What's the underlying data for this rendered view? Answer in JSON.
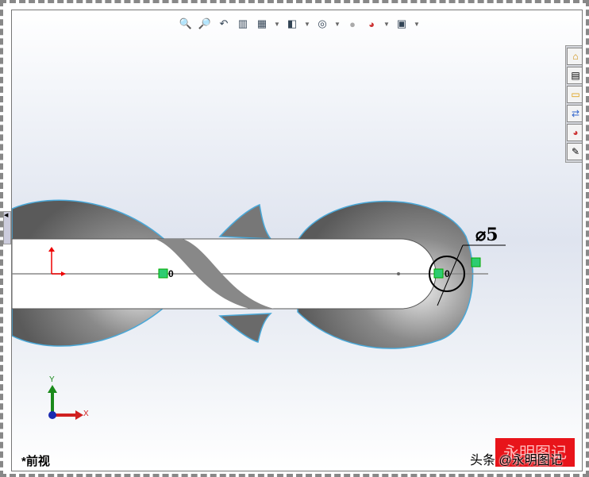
{
  "hud_toolbar": {
    "items": [
      {
        "name": "zoom-to-fit-icon",
        "glyph": "🔍"
      },
      {
        "name": "zoom-to-area-icon",
        "glyph": "🔎"
      },
      {
        "name": "previous-view-icon",
        "glyph": "↶"
      },
      {
        "name": "section-view-icon",
        "glyph": "▥"
      },
      {
        "name": "view-orientation-icon",
        "glyph": "▦",
        "dropdown": true
      },
      {
        "name": "display-style-icon",
        "glyph": "◧",
        "dropdown": true
      },
      {
        "name": "hide-show-items-icon",
        "glyph": "◎",
        "dropdown": true
      },
      {
        "name": "edit-appearance-icon",
        "glyph": "●"
      },
      {
        "name": "apply-scene-icon",
        "glyph": "◕",
        "dropdown": true
      },
      {
        "name": "view-settings-icon",
        "glyph": "▣",
        "dropdown": true
      }
    ]
  },
  "task_pane": {
    "items": [
      {
        "name": "home-icon",
        "glyph": "⌂"
      },
      {
        "name": "design-library-icon",
        "glyph": "▤"
      },
      {
        "name": "file-explorer-icon",
        "glyph": "▭"
      },
      {
        "name": "view-palette-icon",
        "glyph": "⇄"
      },
      {
        "name": "appearances-icon",
        "glyph": "◕"
      },
      {
        "name": "custom-properties-icon",
        "glyph": "✎"
      }
    ]
  },
  "sketch": {
    "dimension": "⌀5",
    "origin_label_1": "0",
    "origin_label_2": "0"
  },
  "triad": {
    "x": "X",
    "y": "Y"
  },
  "view_name": "*前视",
  "watermark": "头条 @永明图记",
  "seal_text": "永明图记",
  "colors": {
    "seal": "#e8141a",
    "triad_x": "#d02020",
    "triad_y": "#1a8a1a",
    "edge": "#4aa8d8"
  }
}
